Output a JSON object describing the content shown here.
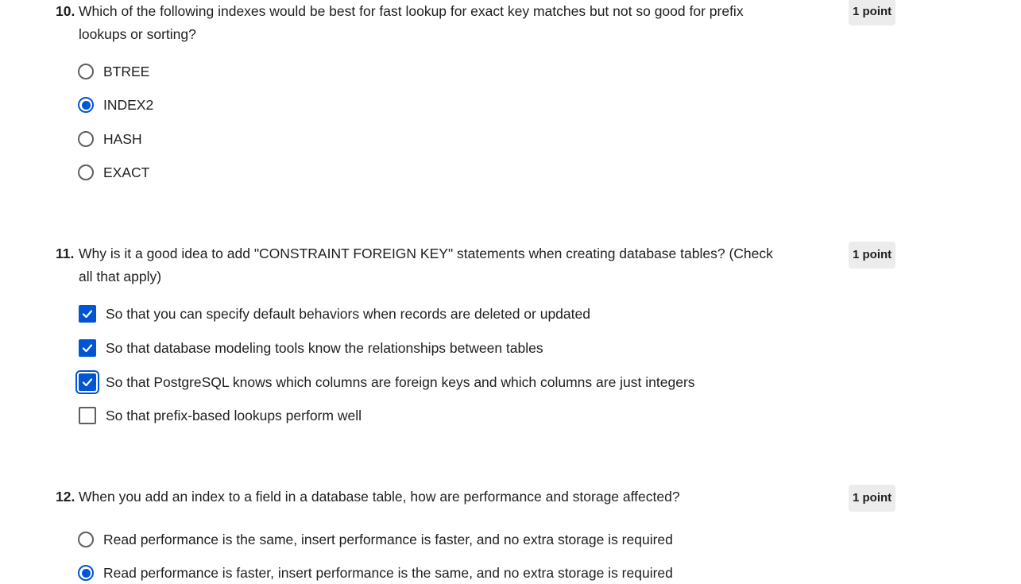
{
  "questions": [
    {
      "number": "10.",
      "text": "Which of the following indexes would be best for fast lookup for exact key matches but not so good for prefix lookups or sorting?",
      "points": "1 point",
      "type": "radio",
      "options": [
        {
          "label": "BTREE",
          "checked": false
        },
        {
          "label": "INDEX2",
          "checked": true
        },
        {
          "label": "HASH",
          "checked": false
        },
        {
          "label": "EXACT",
          "checked": false
        }
      ]
    },
    {
      "number": "11.",
      "text": "Why is it a good idea to add \"CONSTRAINT FOREIGN KEY\" statements when creating database tables? (Check all that apply)",
      "points": "1 point",
      "type": "checkbox",
      "options": [
        {
          "label": "So that you can specify default behaviors when records are deleted or updated",
          "checked": true
        },
        {
          "label": "So that database modeling tools know the relationships between tables",
          "checked": true
        },
        {
          "label": "So that PostgreSQL knows which columns are foreign keys and which columns are just integers",
          "checked": true,
          "focused": true
        },
        {
          "label": "So that prefix-based lookups perform well",
          "checked": false
        }
      ]
    },
    {
      "number": "12.",
      "text": "When you add an index to a field in a database table, how are performance and storage affected?",
      "points": "1 point",
      "type": "radio",
      "options": [
        {
          "label": "Read performance is the same, insert performance is faster, and no extra storage is required",
          "checked": false
        },
        {
          "label": "Read performance is faster, insert performance is the same, and no extra storage is required",
          "checked": true
        }
      ]
    }
  ],
  "colors": {
    "accent": "#0056d2",
    "text": "#1f1f1f",
    "badge_bg": "#ececec",
    "control_border": "#5f5f5f"
  }
}
